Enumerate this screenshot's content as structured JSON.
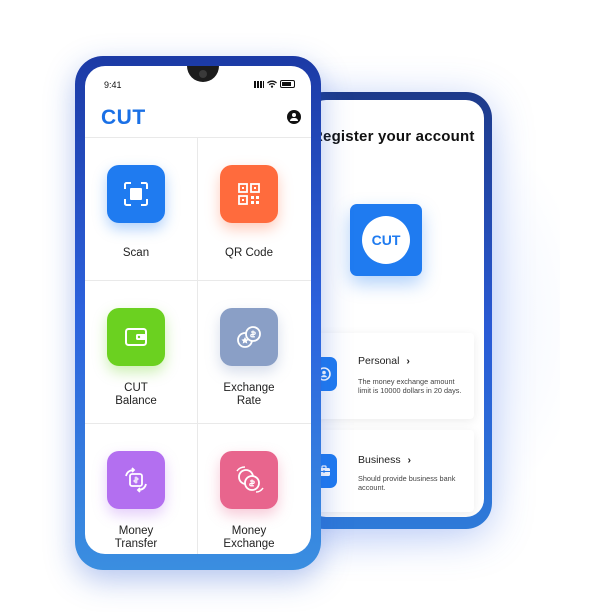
{
  "front": {
    "status_time": "9:41",
    "brand": "CUT",
    "tiles": [
      {
        "label": "Scan",
        "color": "#1f7bf0",
        "icon": "scan-icon"
      },
      {
        "label": "QR Code",
        "color": "#ff6b3d",
        "icon": "qr-code-icon"
      },
      {
        "label": "CUT\nBalance",
        "color": "#6bd120",
        "icon": "wallet-icon"
      },
      {
        "label": "Exchange\nRate",
        "color": "#8a9fc6",
        "icon": "coins-icon"
      },
      {
        "label": "Money\nTransfer",
        "color": "#b36ff0",
        "icon": "transfer-icon"
      },
      {
        "label": "Money\nExchange",
        "color": "#e8658d",
        "icon": "exchange-icon"
      }
    ]
  },
  "back": {
    "title": "Register your account",
    "logo_text": "CUT",
    "personal": {
      "title": "Personal",
      "description": "The money exchange amount limit is 10000 dollars in 20 days."
    },
    "business": {
      "title": "Business",
      "description": "Should provide business bank account."
    }
  }
}
